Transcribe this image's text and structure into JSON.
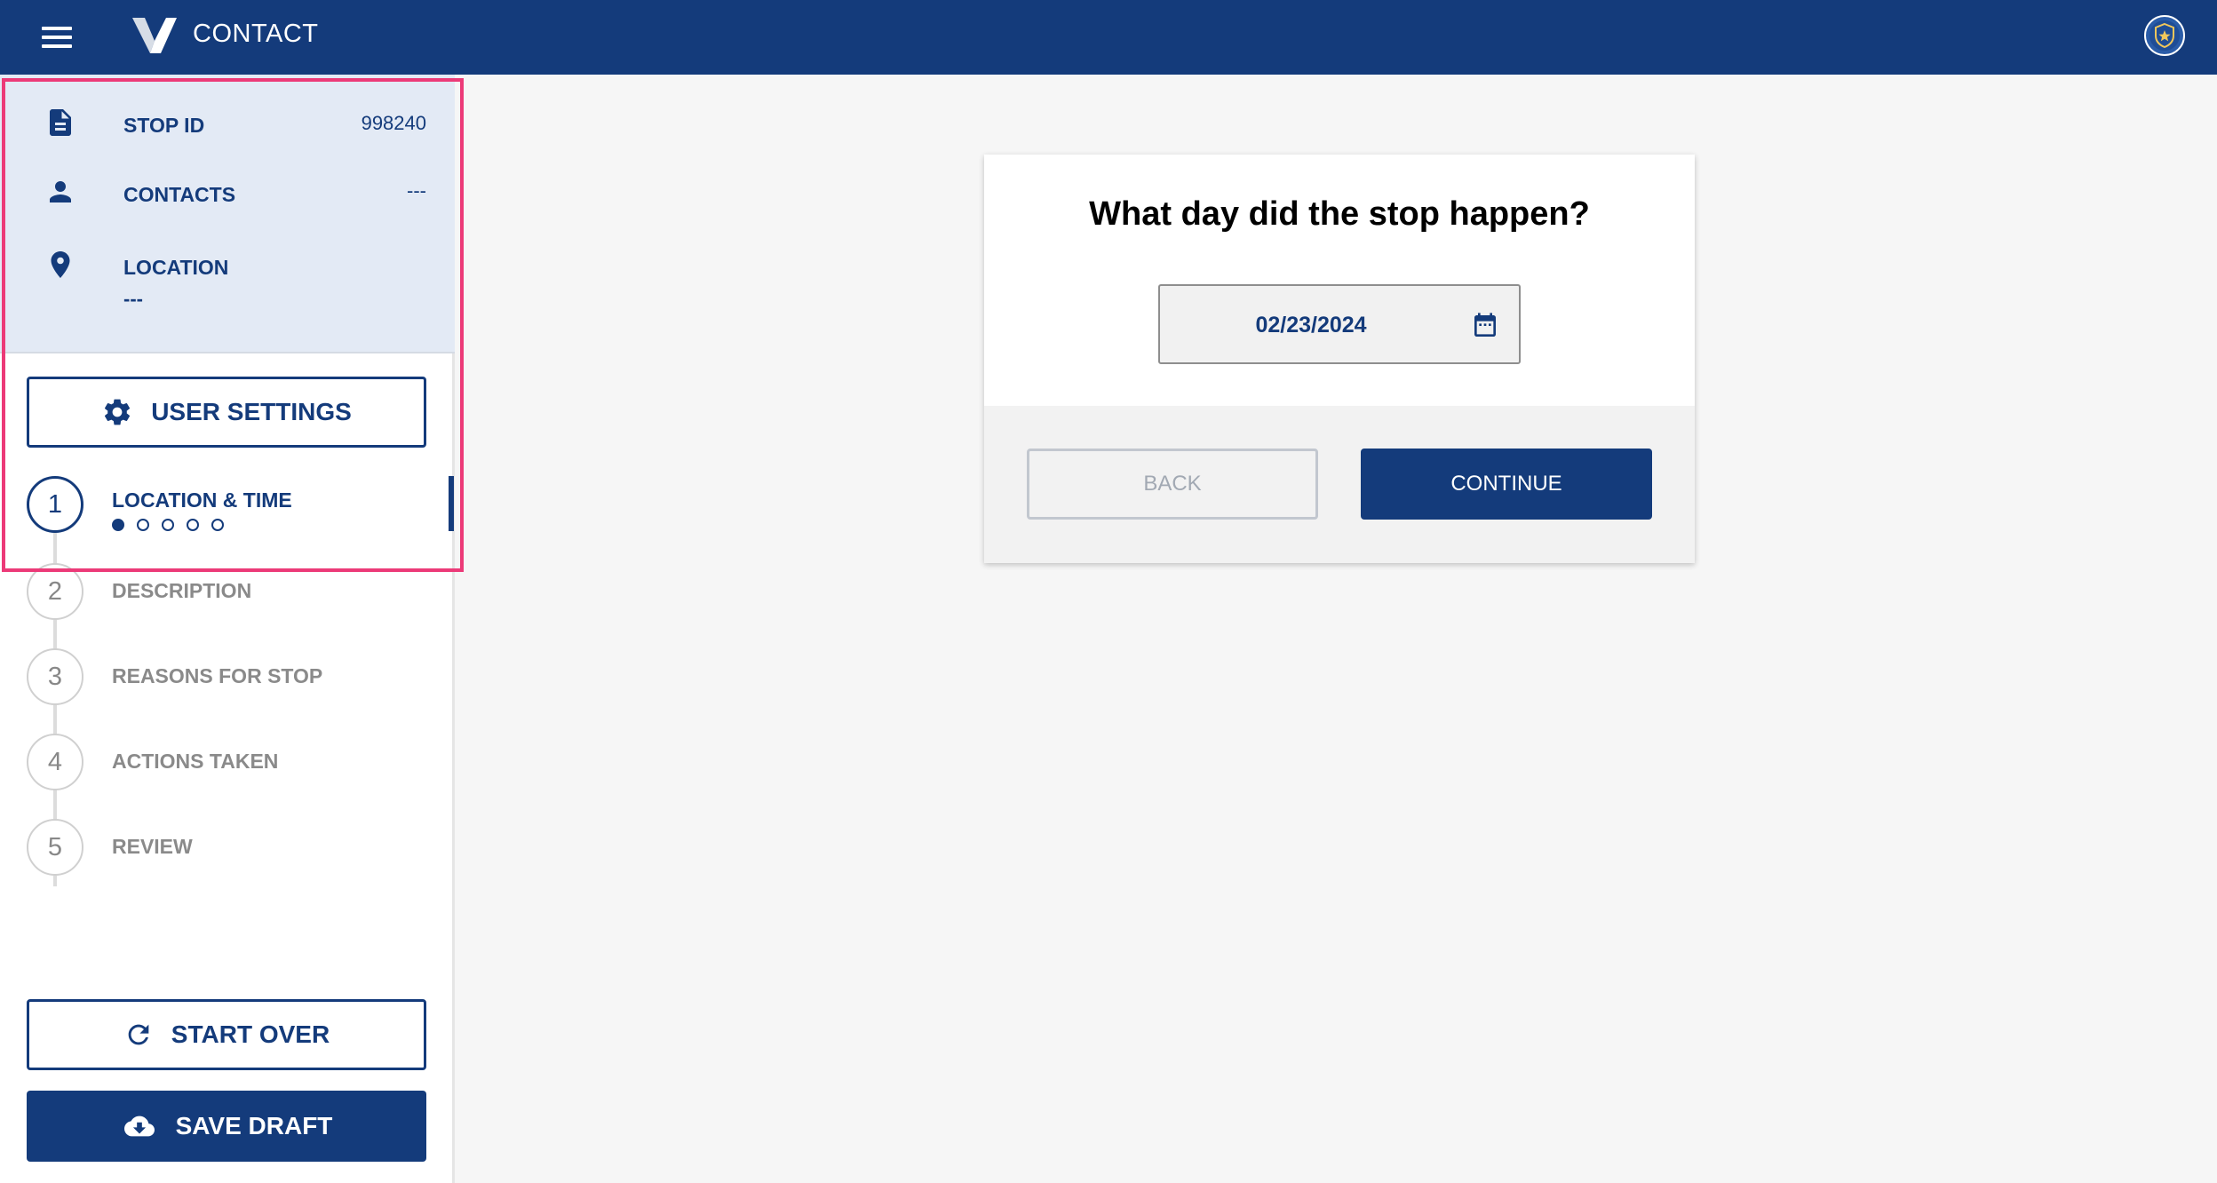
{
  "app": {
    "title": "CONTACT"
  },
  "summary": {
    "stop_id_label": "STOP ID",
    "stop_id_value": "998240",
    "contacts_label": "CONTACTS",
    "contacts_value": "---",
    "location_label": "LOCATION",
    "location_value": "---"
  },
  "sidebar": {
    "user_settings_label": "USER SETTINGS",
    "steps": [
      {
        "number": "1",
        "label": "LOCATION & TIME"
      },
      {
        "number": "2",
        "label": "DESCRIPTION"
      },
      {
        "number": "3",
        "label": "REASONS FOR STOP"
      },
      {
        "number": "4",
        "label": "ACTIONS TAKEN"
      },
      {
        "number": "5",
        "label": "REVIEW"
      }
    ],
    "active_substep": 1,
    "substep_count": 5,
    "start_over_label": "START OVER",
    "save_draft_label": "SAVE DRAFT"
  },
  "main": {
    "question": "What day did the stop happen?",
    "date_value": "02/23/2024",
    "back_label": "BACK",
    "continue_label": "CONTINUE"
  },
  "colors": {
    "primary": "#143b7b",
    "highlight": "#ec3a78",
    "summary_bg": "#e3eaf5"
  }
}
